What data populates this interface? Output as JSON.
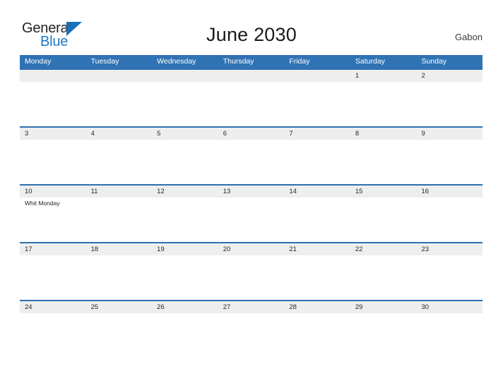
{
  "brand": {
    "name_line1": "General",
    "name_line2": "Blue",
    "triangle_icon": "triangle-logo-icon",
    "color_dark": "#231f20",
    "color_blue": "#1f78c1"
  },
  "header": {
    "title": "June 2030",
    "country": "Gabon"
  },
  "colors": {
    "header_blue": "#3073b4",
    "row_divider_blue": "#2e70b0",
    "number_band_gray": "#eeeeee",
    "cell_white": "#ffffff",
    "text_dark": "#272727"
  },
  "calendar": {
    "weekdays": [
      "Monday",
      "Tuesday",
      "Wednesday",
      "Thursday",
      "Friday",
      "Saturday",
      "Sunday"
    ],
    "weeks": [
      {
        "days": [
          {
            "number": "",
            "event": ""
          },
          {
            "number": "",
            "event": ""
          },
          {
            "number": "",
            "event": ""
          },
          {
            "number": "",
            "event": ""
          },
          {
            "number": "",
            "event": ""
          },
          {
            "number": "1",
            "event": ""
          },
          {
            "number": "2",
            "event": ""
          }
        ]
      },
      {
        "days": [
          {
            "number": "3",
            "event": ""
          },
          {
            "number": "4",
            "event": ""
          },
          {
            "number": "5",
            "event": ""
          },
          {
            "number": "6",
            "event": ""
          },
          {
            "number": "7",
            "event": ""
          },
          {
            "number": "8",
            "event": ""
          },
          {
            "number": "9",
            "event": ""
          }
        ]
      },
      {
        "days": [
          {
            "number": "10",
            "event": "Whit Monday"
          },
          {
            "number": "11",
            "event": ""
          },
          {
            "number": "12",
            "event": ""
          },
          {
            "number": "13",
            "event": ""
          },
          {
            "number": "14",
            "event": ""
          },
          {
            "number": "15",
            "event": ""
          },
          {
            "number": "16",
            "event": ""
          }
        ]
      },
      {
        "days": [
          {
            "number": "17",
            "event": ""
          },
          {
            "number": "18",
            "event": ""
          },
          {
            "number": "19",
            "event": ""
          },
          {
            "number": "20",
            "event": ""
          },
          {
            "number": "21",
            "event": ""
          },
          {
            "number": "22",
            "event": ""
          },
          {
            "number": "23",
            "event": ""
          }
        ]
      },
      {
        "days": [
          {
            "number": "24",
            "event": ""
          },
          {
            "number": "25",
            "event": ""
          },
          {
            "number": "26",
            "event": ""
          },
          {
            "number": "27",
            "event": ""
          },
          {
            "number": "28",
            "event": ""
          },
          {
            "number": "29",
            "event": ""
          },
          {
            "number": "30",
            "event": ""
          }
        ]
      }
    ]
  }
}
